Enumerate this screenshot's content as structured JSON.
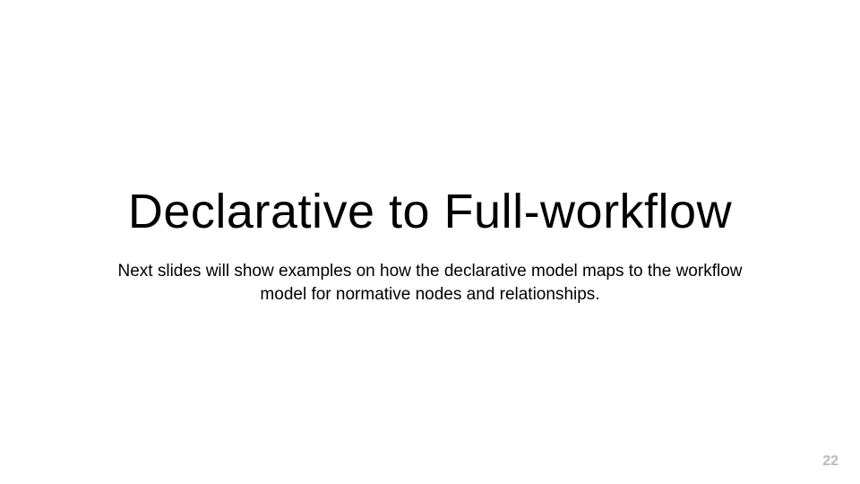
{
  "slide": {
    "title": "Declarative to Full-workflow",
    "body": "Next slides will show examples on how the declarative model maps to the workflow model for normative nodes and relationships.",
    "page_number": "22"
  }
}
